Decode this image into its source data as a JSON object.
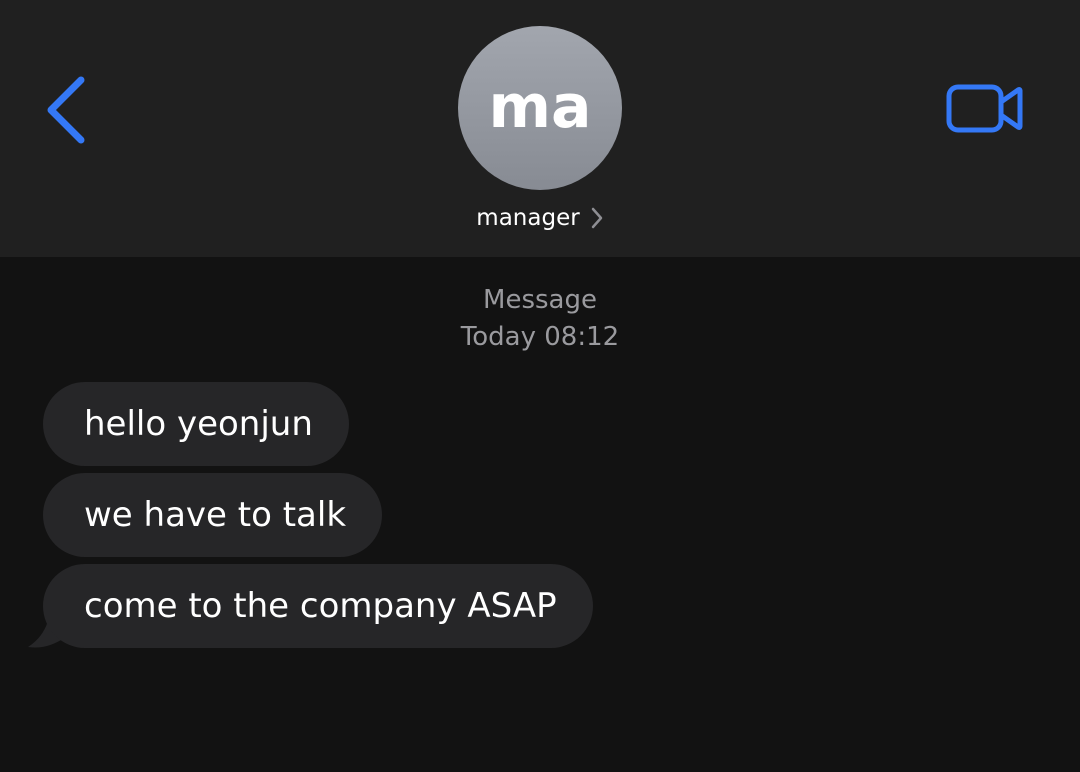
{
  "header": {
    "back_icon": "chevron-left-icon",
    "video_icon": "video-camera-icon",
    "avatar_initials": "ma",
    "contact_name": "manager",
    "contact_chevron_icon": "chevron-right-icon"
  },
  "conversation": {
    "service_label": "Message",
    "timestamp": "Today 08:12",
    "messages": [
      {
        "text": "hello yeonjun",
        "direction": "incoming"
      },
      {
        "text": "we have to talk",
        "direction": "incoming"
      },
      {
        "text": "come to the company ASAP",
        "direction": "incoming"
      }
    ]
  },
  "colors": {
    "accent": "#3478F6",
    "header_bg": "#202020",
    "body_bg": "#121212",
    "bubble_bg": "#262628",
    "avatar_bg": "#9A9EA6",
    "secondary_text": "#9A9A9E"
  }
}
